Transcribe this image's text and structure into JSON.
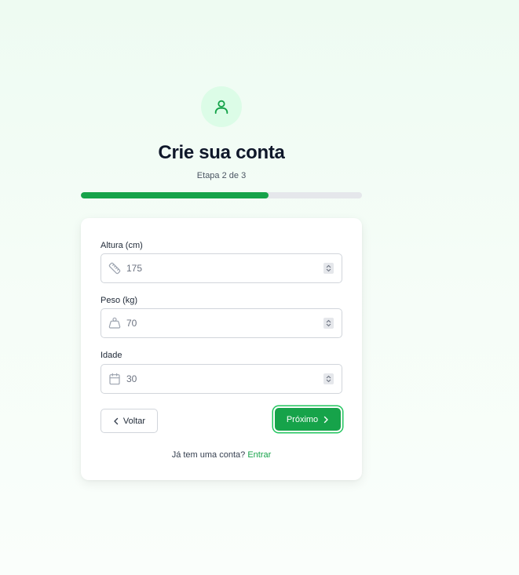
{
  "header": {
    "title": "Crie sua conta",
    "step_text": "Etapa 2 de 3",
    "progress_fraction": 0.667
  },
  "form": {
    "fields": [
      {
        "label": "Altura (cm)",
        "value": "175",
        "icon": "ruler-icon"
      },
      {
        "label": "Peso (kg)",
        "value": "70",
        "icon": "weight-icon"
      },
      {
        "label": "Idade",
        "value": "30",
        "icon": "calendar-icon"
      }
    ],
    "back_label": "Voltar",
    "next_label": "Próximo"
  },
  "footer": {
    "prompt": "Já tem uma conta?",
    "link": "Entrar"
  },
  "colors": {
    "accent": "#16a34a",
    "avatar_bg": "#dcfce7",
    "progress_track": "#e5e7eb"
  }
}
